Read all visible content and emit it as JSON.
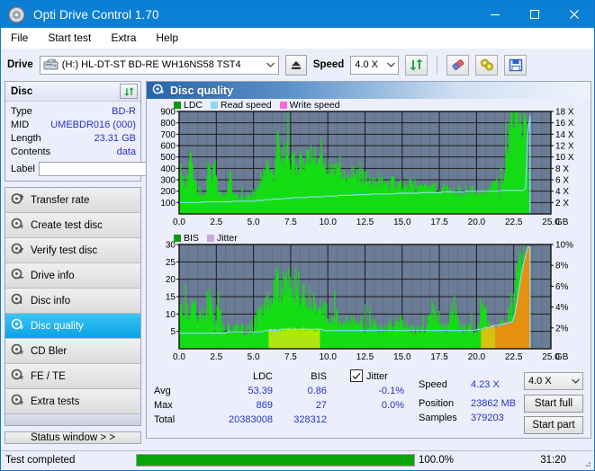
{
  "window": {
    "title": "Opti Drive Control 1.70",
    "icon": "disc-icon",
    "minimize": "minimize-icon",
    "maximize": "maximize-icon",
    "close": "close-icon"
  },
  "menubar": {
    "items": [
      {
        "label": "File"
      },
      {
        "label": "Start test"
      },
      {
        "label": "Extra"
      },
      {
        "label": "Help"
      }
    ]
  },
  "drivebar": {
    "drive_label": "Drive",
    "drive_value": "(H:)  HL-DT-ST BD-RE  WH16NS58 TST4",
    "eject_icon": "eject-icon",
    "speed_label": "Speed",
    "speed_value": "4.0 X",
    "refresh_icon": "refresh-icon",
    "erase_icon": "eraser-icon",
    "settings_icon": "bulb-icon",
    "save_icon": "floppy-disk-icon"
  },
  "disc_panel": {
    "title": "Disc",
    "refresh_icon": "refresh-icon",
    "rows": [
      {
        "key": "Type",
        "value": "BD-R"
      },
      {
        "key": "MID",
        "value": "UMEBDR016 (000)"
      },
      {
        "key": "Length",
        "value": "23.31 GB"
      },
      {
        "key": "Contents",
        "value": "data"
      }
    ],
    "label_key": "Label",
    "label_value": "",
    "label_placeholder": "",
    "disc_icon": "cd-disc-icon"
  },
  "nav": {
    "items": [
      {
        "label": "Transfer rate",
        "icon": "transfer-rate-icon",
        "active": false
      },
      {
        "label": "Create test disc",
        "icon": "create-disc-icon",
        "active": false
      },
      {
        "label": "Verify test disc",
        "icon": "verify-disc-icon",
        "active": false
      },
      {
        "label": "Drive info",
        "icon": "drive-info-icon",
        "active": false
      },
      {
        "label": "Disc info",
        "icon": "disc-info-icon",
        "active": false
      },
      {
        "label": "Disc quality",
        "icon": "disc-quality-icon",
        "active": true
      },
      {
        "label": "CD Bler",
        "icon": "cd-bler-icon",
        "active": false
      },
      {
        "label": "FE / TE",
        "icon": "fe-te-icon",
        "active": false
      },
      {
        "label": "Extra tests",
        "icon": "extra-tests-icon",
        "active": false
      }
    ],
    "status_window": "Status window > >"
  },
  "content": {
    "title": "Disc quality",
    "icon": "disc-quality-icon"
  },
  "stats": {
    "col_ldc": "LDC",
    "col_bis": "BIS",
    "rows": [
      {
        "label": "Avg",
        "ldc": "53.39",
        "bis": "0.86"
      },
      {
        "label": "Max",
        "ldc": "869",
        "bis": "27"
      },
      {
        "label": "Total",
        "ldc": "20383008",
        "bis": "328312"
      }
    ],
    "jitter_label": "Jitter",
    "jitter_checked": true,
    "jitter_avg": "-0.1%",
    "jitter_max": "0.0%",
    "speed_label": "Speed",
    "speed_value": "4.23 X",
    "position_label": "Position",
    "position_value": "23862 MB",
    "samples_label": "Samples",
    "samples_value": "379203",
    "speed_select": "4.0 X",
    "start_full": "Start full",
    "start_part": "Start part"
  },
  "statusbar": {
    "message": "Test completed",
    "percent": "100.0%",
    "percent_value": 100,
    "elapsed": "31:20"
  },
  "colors": {
    "accent": "#0b7fd4",
    "plot_bg": "#6b7c96",
    "ldc_green": "#14dd14",
    "read_speed": "#8fd8f5",
    "write_speed": "#f56ae0",
    "jitter": "#c8a8d8",
    "value_blue": "#2433c0",
    "progress_green": "#08a508"
  },
  "chart_data": [
    {
      "type": "area",
      "name": "ldc-chart",
      "title": "",
      "xlabel": "GB",
      "ylabel": "",
      "xlim": [
        0,
        25
      ],
      "xticks": [
        "0.0",
        "2.5",
        "5.0",
        "7.5",
        "10.0",
        "12.5",
        "15.0",
        "17.5",
        "20.0",
        "22.5",
        "25.0"
      ],
      "ylim": [
        0,
        900
      ],
      "yticks": [
        100,
        200,
        300,
        400,
        500,
        600,
        700,
        800,
        900
      ],
      "y2lim": [
        0,
        18
      ],
      "y2ticks": [
        "2 X",
        "4 X",
        "6 X",
        "8 X",
        "10 X",
        "12 X",
        "14 X",
        "16 X",
        "18 X"
      ],
      "grid": true,
      "legend": [
        {
          "label": "LDC",
          "color": "#0a9a0a"
        },
        {
          "label": "Read speed",
          "color": "#8fd8f5"
        },
        {
          "label": "Write speed",
          "color": "#f56ae0"
        }
      ],
      "series": [
        {
          "name": "LDC",
          "color": "#14dd14",
          "x": [
            0.0,
            0.2,
            0.4,
            0.6,
            0.8,
            1.0,
            1.2,
            1.4,
            1.6,
            1.8,
            2.0,
            2.2,
            2.4,
            2.6,
            2.8,
            3.0,
            3.2,
            3.4,
            3.6,
            3.8,
            4.0,
            4.2,
            4.4,
            4.6,
            4.8,
            5.0,
            5.2,
            5.4,
            5.6,
            5.8,
            6.0,
            6.2,
            6.4,
            6.6,
            6.8,
            7.0,
            7.2,
            7.4,
            7.6,
            7.8,
            8.0,
            8.2,
            8.4,
            8.6,
            8.8,
            9.0,
            9.2,
            9.4,
            9.6,
            9.8,
            10.0,
            10.4,
            10.8,
            11.2,
            11.6,
            12.0,
            12.4,
            12.8,
            13.2,
            13.6,
            14.0,
            14.4,
            14.8,
            15.2,
            15.6,
            16.0,
            16.4,
            16.8,
            17.2,
            17.6,
            18.0,
            18.4,
            18.8,
            19.2,
            19.6,
            20.0,
            20.4,
            20.8,
            21.2,
            21.6,
            22.0,
            22.4,
            22.8,
            23.0,
            23.2,
            23.4,
            23.6
          ],
          "values": [
            355,
            300,
            250,
            260,
            520,
            300,
            200,
            185,
            160,
            180,
            490,
            170,
            595,
            160,
            150,
            155,
            145,
            400,
            150,
            150,
            140,
            145,
            150,
            150,
            155,
            170,
            200,
            250,
            300,
            330,
            355,
            350,
            340,
            600,
            420,
            470,
            420,
            415,
            410,
            420,
            400,
            520,
            430,
            430,
            455,
            430,
            450,
            410,
            400,
            380,
            360,
            355,
            340,
            330,
            320,
            315,
            300,
            295,
            280,
            270,
            260,
            255,
            250,
            240,
            235,
            230,
            225,
            220,
            215,
            210,
            205,
            200,
            195,
            190,
            185,
            180,
            175,
            170,
            300,
            160,
            420,
            760,
            870,
            700,
            820,
            540,
            60
          ]
        },
        {
          "name": "Read speed",
          "color": "#8fd8f5",
          "x": [
            0.0,
            2.5,
            5.0,
            7.5,
            10.0,
            12.5,
            15.0,
            17.5,
            20.0,
            22.5,
            23.3,
            23.5
          ],
          "values": [
            2.0,
            2.1,
            2.3,
            2.8,
            3.1,
            3.4,
            3.6,
            3.8,
            4.0,
            4.1,
            4.2,
            17.3
          ]
        }
      ]
    },
    {
      "type": "area",
      "name": "bis-jitter-chart",
      "title": "",
      "xlabel": "GB",
      "ylabel": "",
      "xlim": [
        0,
        25
      ],
      "xticks": [
        "0.0",
        "2.5",
        "5.0",
        "7.5",
        "10.0",
        "12.5",
        "15.0",
        "17.5",
        "20.0",
        "22.5",
        "25.0"
      ],
      "ylim": [
        0,
        30
      ],
      "yticks": [
        5,
        10,
        15,
        20,
        25,
        30
      ],
      "y2lim": [
        0,
        10
      ],
      "y2ticks": [
        "2%",
        "4%",
        "6%",
        "8%",
        "10%"
      ],
      "grid": true,
      "legend": [
        {
          "label": "BIS",
          "color": "#0a9a0a"
        },
        {
          "label": "Jitter",
          "color": "#c8a8d8"
        }
      ],
      "series": [
        {
          "name": "BIS",
          "color": "#14dd14",
          "x": [
            0.0,
            0.3,
            0.6,
            0.9,
            1.2,
            1.5,
            1.8,
            2.1,
            2.4,
            2.7,
            3.0,
            3.3,
            3.6,
            3.9,
            4.2,
            4.5,
            4.8,
            5.1,
            5.4,
            5.7,
            6.0,
            6.3,
            6.6,
            6.9,
            7.2,
            7.5,
            7.8,
            8.1,
            8.4,
            8.7,
            9.0,
            9.3,
            9.6,
            9.9,
            10.5,
            11.0,
            11.5,
            12.0,
            12.5,
            13.0,
            13.5,
            14.0,
            14.5,
            15.0,
            15.5,
            16.0,
            16.5,
            17.0,
            17.5,
            18.0,
            18.5,
            19.0,
            19.5,
            20.0,
            20.5,
            21.0,
            21.5,
            22.0,
            22.4,
            22.8,
            23.0,
            23.2,
            23.4,
            23.6
          ],
          "values": [
            12,
            9,
            10,
            10,
            8,
            9,
            11,
            12,
            6,
            12,
            5,
            5,
            5,
            5,
            5,
            5,
            5,
            7,
            9,
            11,
            12,
            14,
            16,
            15,
            16,
            17,
            16,
            15,
            14,
            13,
            12,
            11,
            10,
            9,
            8,
            7,
            7,
            7,
            6,
            6,
            5,
            6,
            6,
            7,
            5,
            5,
            5,
            11,
            5,
            5,
            11,
            5,
            5,
            5,
            10,
            5,
            6,
            8,
            12,
            20,
            24,
            26,
            22,
            2
          ]
        },
        {
          "name": "Jitter",
          "color": "#c8a8d8",
          "x": [
            0.0,
            5.0,
            7.5,
            10.0,
            15.0,
            20.0,
            22.5,
            23.0,
            23.4
          ],
          "values": [
            1.5,
            1.6,
            1.9,
            1.8,
            1.7,
            1.8,
            2.6,
            7.0,
            9.7
          ]
        }
      ]
    }
  ]
}
